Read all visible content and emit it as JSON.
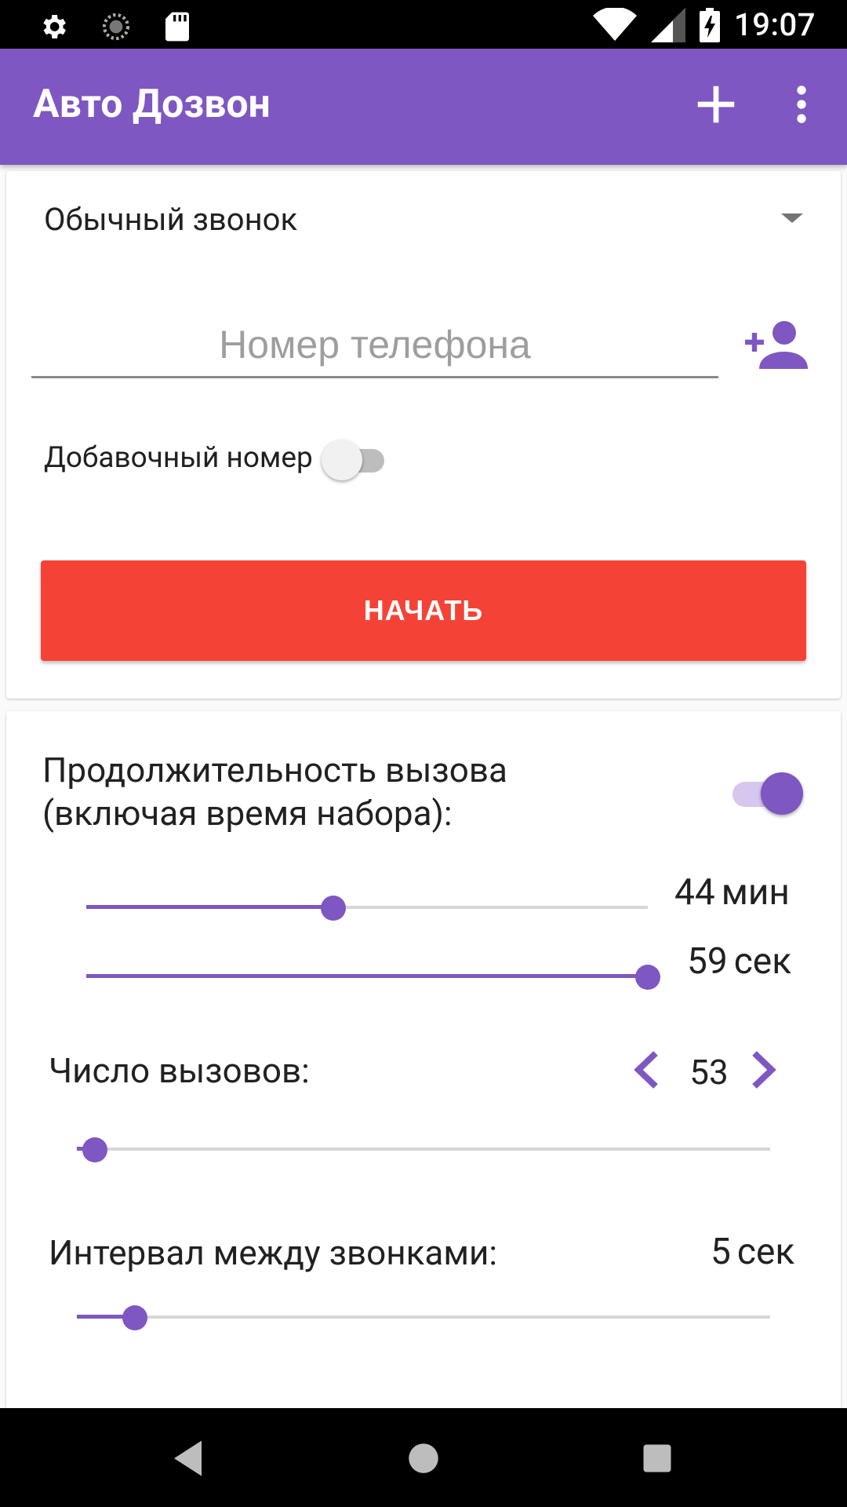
{
  "status_bar": {
    "time": "19:07",
    "icons": [
      "settings-icon",
      "sync-icon",
      "sd-card-icon",
      "wifi-icon",
      "cell-signal-icon",
      "battery-charging-icon"
    ]
  },
  "app_bar": {
    "title": "Авто Дозвон",
    "actions": [
      "add-icon",
      "more-vert-icon"
    ],
    "color": "#7e57c2"
  },
  "call_card": {
    "call_type": "Обычный звонок",
    "phone_placeholder": "Номер телефона",
    "phone_value": "",
    "extension_label": "Добавочный номер",
    "extension_enabled": false,
    "start_label": "НАЧАТЬ",
    "start_color": "#f44336"
  },
  "settings_card": {
    "duration_label_line1": "Продолжительность вызова",
    "duration_label_line2": "(включая время набора):",
    "duration_enabled": true,
    "minutes": {
      "value": "44",
      "unit": "мин",
      "fraction": 0.44
    },
    "seconds": {
      "value": "59",
      "unit": "сек",
      "fraction": 1.0
    },
    "calls": {
      "label": "Число вызовов:",
      "value": "53",
      "fraction": 0.026
    },
    "interval": {
      "label": "Интервал между звонками:",
      "value": "5",
      "unit": "сек",
      "fraction": 0.084
    }
  },
  "nav_bar": {
    "buttons": [
      "back-icon",
      "home-icon",
      "recents-icon"
    ]
  }
}
